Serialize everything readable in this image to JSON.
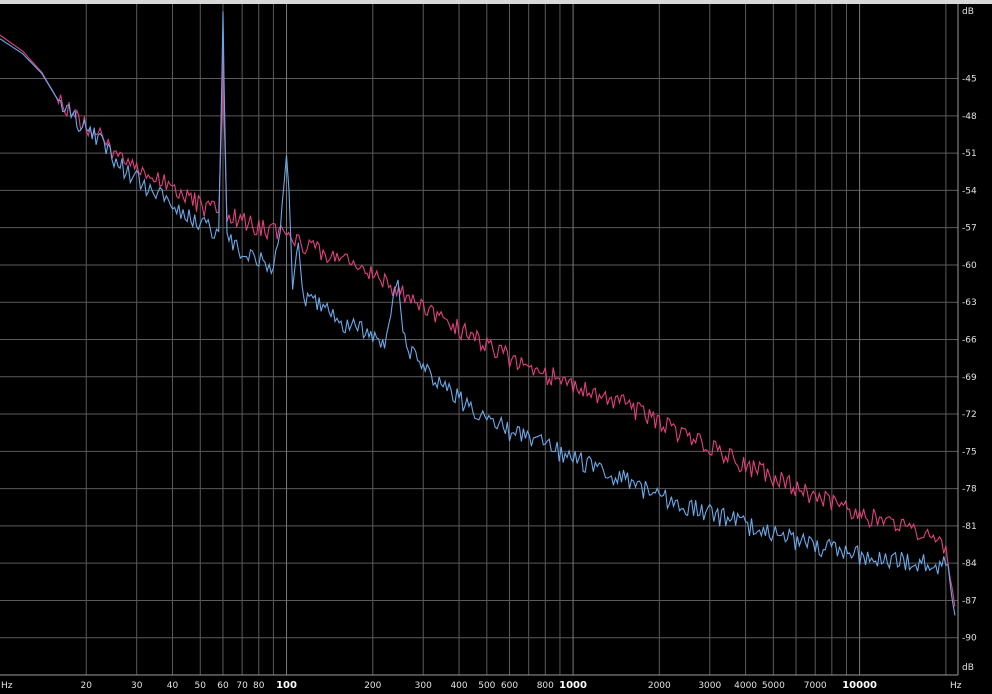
{
  "chart_data": {
    "type": "line",
    "xscale": "log",
    "xlim": [
      10,
      22050
    ],
    "ylim": [
      -93,
      -39
    ],
    "xunit_label": "Hz",
    "yunit_label": "dB",
    "grid": true,
    "legend": "none",
    "background_color": "#000000",
    "grid_color": "#5a5a5a",
    "x_ticks": [
      {
        "value": 20,
        "label": "20",
        "major": false
      },
      {
        "value": 30,
        "label": "30",
        "major": false
      },
      {
        "value": 40,
        "label": "40",
        "major": false
      },
      {
        "value": 50,
        "label": "50",
        "major": false
      },
      {
        "value": 60,
        "label": "60",
        "major": false
      },
      {
        "value": 70,
        "label": "70",
        "major": false
      },
      {
        "value": 80,
        "label": "80",
        "major": false
      },
      {
        "value": 100,
        "label": "100",
        "major": true
      },
      {
        "value": 200,
        "label": "200",
        "major": false
      },
      {
        "value": 300,
        "label": "300",
        "major": false
      },
      {
        "value": 400,
        "label": "400",
        "major": false
      },
      {
        "value": 500,
        "label": "500",
        "major": false
      },
      {
        "value": 600,
        "label": "600",
        "major": false
      },
      {
        "value": 800,
        "label": "800",
        "major": false
      },
      {
        "value": 1000,
        "label": "1000",
        "major": true
      },
      {
        "value": 2000,
        "label": "2000",
        "major": false
      },
      {
        "value": 3000,
        "label": "3000",
        "major": false
      },
      {
        "value": 4000,
        "label": "4000",
        "major": false
      },
      {
        "value": 5000,
        "label": "5000",
        "major": false
      },
      {
        "value": 7000,
        "label": "7000",
        "major": false
      },
      {
        "value": 10000,
        "label": "10000",
        "major": true
      }
    ],
    "y_ticks": [
      -45,
      -48,
      -51,
      -54,
      -57,
      -60,
      -63,
      -66,
      -69,
      -72,
      -75,
      -78,
      -81,
      -84,
      -87,
      -90
    ],
    "series": [
      {
        "color": "#e0407e",
        "points": [
          [
            10,
            -41.5
          ],
          [
            12,
            -42.8
          ],
          [
            14,
            -44.5
          ],
          [
            16,
            -46.8
          ],
          [
            18,
            -48.0
          ],
          [
            20,
            -48.8
          ],
          [
            22,
            -49.5
          ],
          [
            25,
            -51.0
          ],
          [
            28,
            -51.8
          ],
          [
            30,
            -52.0
          ],
          [
            35,
            -53.0
          ],
          [
            40,
            -53.8
          ],
          [
            45,
            -54.6
          ],
          [
            50,
            -55.2
          ],
          [
            55,
            -55.6
          ],
          [
            58,
            -55.8
          ],
          [
            59.5,
            -48.0
          ],
          [
            60,
            -41.0
          ],
          [
            60.5,
            -48.0
          ],
          [
            62,
            -56.0
          ],
          [
            65,
            -56.2
          ],
          [
            70,
            -56.5
          ],
          [
            80,
            -57.0
          ],
          [
            90,
            -57.3
          ],
          [
            100,
            -57.8
          ],
          [
            120,
            -58.5
          ],
          [
            150,
            -59.3
          ],
          [
            180,
            -60.3
          ],
          [
            200,
            -60.8
          ],
          [
            250,
            -62.2
          ],
          [
            300,
            -63.6
          ],
          [
            400,
            -65.2
          ],
          [
            500,
            -66.5
          ],
          [
            600,
            -67.5
          ],
          [
            800,
            -68.8
          ],
          [
            1000,
            -69.6
          ],
          [
            1500,
            -71.2
          ],
          [
            2000,
            -72.7
          ],
          [
            3000,
            -74.7
          ],
          [
            4000,
            -76.1
          ],
          [
            5000,
            -77.1
          ],
          [
            7000,
            -78.6
          ],
          [
            10000,
            -80.0
          ],
          [
            14000,
            -81.2
          ],
          [
            17000,
            -81.9
          ],
          [
            19000,
            -82.4
          ],
          [
            20000,
            -83.2
          ],
          [
            21000,
            -85.5
          ],
          [
            21500,
            -87.5
          ]
        ]
      },
      {
        "color": "#6aa8e8",
        "points": [
          [
            10,
            -41.8
          ],
          [
            12,
            -43.0
          ],
          [
            14,
            -44.6
          ],
          [
            16,
            -46.8
          ],
          [
            18,
            -48.2
          ],
          [
            20,
            -49.0
          ],
          [
            22,
            -50.0
          ],
          [
            25,
            -51.5
          ],
          [
            28,
            -52.6
          ],
          [
            30,
            -53.1
          ],
          [
            35,
            -54.3
          ],
          [
            40,
            -55.0
          ],
          [
            45,
            -56.0
          ],
          [
            50,
            -56.7
          ],
          [
            55,
            -57.2
          ],
          [
            58,
            -57.3
          ],
          [
            59.5,
            -45.0
          ],
          [
            60,
            -39.6
          ],
          [
            60.5,
            -45.0
          ],
          [
            62,
            -57.7
          ],
          [
            65,
            -58.3
          ],
          [
            70,
            -58.9
          ],
          [
            80,
            -59.6
          ],
          [
            90,
            -60.4
          ],
          [
            95,
            -56.8
          ],
          [
            98,
            -53.0
          ],
          [
            100,
            -51.0
          ],
          [
            102,
            -54.0
          ],
          [
            105,
            -61.8
          ],
          [
            110,
            -58.2
          ],
          [
            115,
            -63.4
          ],
          [
            120,
            -62.8
          ],
          [
            150,
            -64.4
          ],
          [
            180,
            -65.2
          ],
          [
            200,
            -65.7
          ],
          [
            220,
            -66.4
          ],
          [
            235,
            -63.5
          ],
          [
            245,
            -61.2
          ],
          [
            255,
            -65.6
          ],
          [
            270,
            -67.2
          ],
          [
            300,
            -68.2
          ],
          [
            400,
            -70.8
          ],
          [
            500,
            -72.2
          ],
          [
            600,
            -73.4
          ],
          [
            800,
            -74.6
          ],
          [
            1000,
            -75.6
          ],
          [
            1500,
            -77.3
          ],
          [
            2000,
            -78.6
          ],
          [
            3000,
            -80.0
          ],
          [
            4000,
            -80.9
          ],
          [
            5000,
            -81.7
          ],
          [
            7000,
            -82.6
          ],
          [
            10000,
            -83.4
          ],
          [
            14000,
            -83.8
          ],
          [
            17000,
            -84.0
          ],
          [
            20000,
            -84.2
          ],
          [
            21000,
            -86.2
          ],
          [
            21500,
            -88.2
          ]
        ]
      }
    ]
  }
}
